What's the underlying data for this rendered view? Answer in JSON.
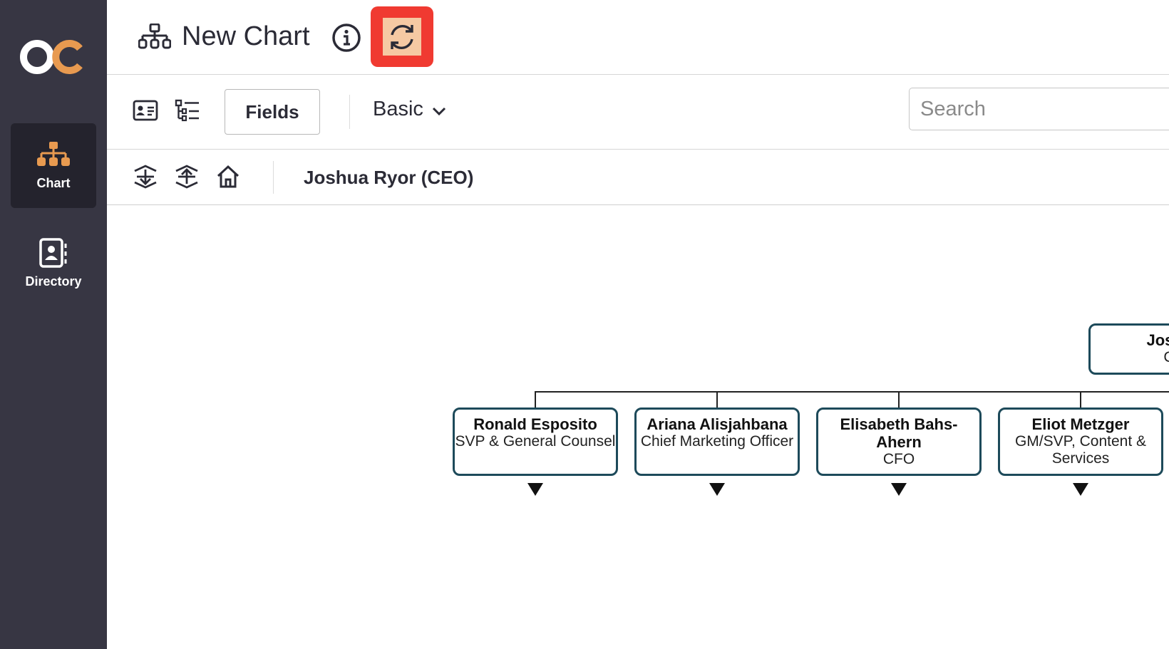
{
  "sidebar": {
    "logo_text": "OC",
    "items": [
      {
        "label": "Chart",
        "icon": "org-chart-icon",
        "active": true
      },
      {
        "label": "Directory",
        "icon": "contact-book-icon",
        "active": false
      }
    ]
  },
  "header": {
    "title": "New Chart",
    "title_icon": "org-chart-icon",
    "info_icon": "info-icon",
    "refresh_icon": "refresh-icon"
  },
  "toolbar": {
    "fields_label": "Fields",
    "view_mode": "Basic",
    "search_placeholder": "Search"
  },
  "breadcrumb": {
    "current": "Joshua Ryor (CEO)"
  },
  "org": {
    "root": {
      "name": "Joshua",
      "title": "CE"
    },
    "children": [
      {
        "name": "Ronald Esposito",
        "title": "SVP & General Counsel"
      },
      {
        "name": "Ariana Alisjahbana",
        "title": "Chief Marketing Officer"
      },
      {
        "name": "Elisabeth Bahs-Ahern",
        "title": "CFO"
      },
      {
        "name": "Eliot Metzger",
        "title": "GM/SVP, Content & Services"
      }
    ]
  },
  "colors": {
    "sidebar_bg": "#373643",
    "sidebar_active": "#24232d",
    "accent_orange": "#e89a50",
    "node_border": "#1d4a5a",
    "highlight_red": "#f03a31"
  }
}
